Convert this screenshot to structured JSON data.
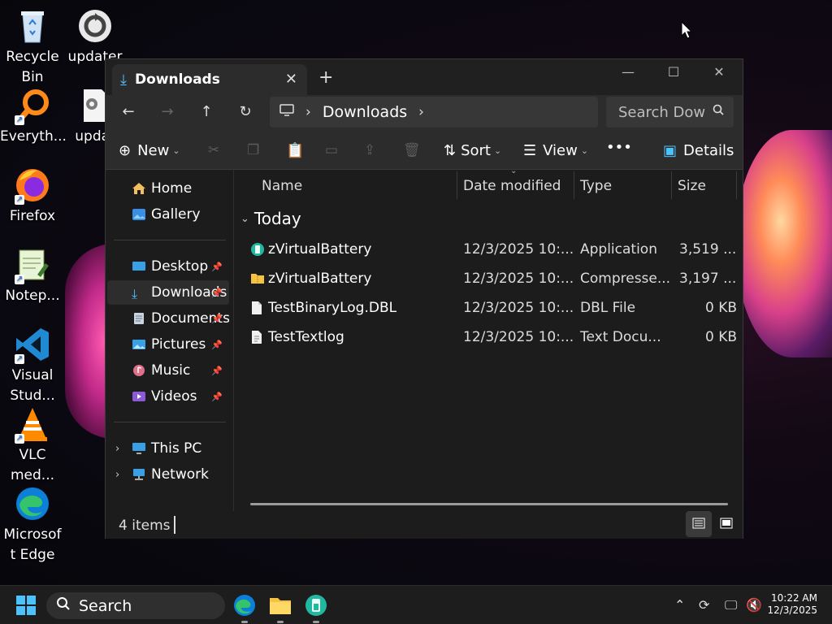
{
  "desktop": {
    "icons": [
      {
        "label": "Recycle Bin",
        "icon": "recycle-bin-icon"
      },
      {
        "label": "updater",
        "icon": "updater-icon"
      },
      {
        "label": "Everyth...",
        "icon": "everything-icon"
      },
      {
        "label": "updat",
        "icon": "updater-gear-icon"
      },
      {
        "label": "Firefox",
        "icon": "firefox-icon"
      },
      {
        "label": "Notep...",
        "icon": "notepad-icon"
      },
      {
        "label": "Visual Stud...",
        "icon": "visual-studio-code-icon"
      },
      {
        "label": "VLC med...",
        "icon": "vlc-icon"
      },
      {
        "label": "Microsof t Edge",
        "icon": "edge-icon"
      }
    ]
  },
  "window": {
    "tab_title": "Downloads",
    "tab_close": "✕",
    "new_tab": "+",
    "minimize": "—",
    "maximize": "☐",
    "close": "✕"
  },
  "navbar": {
    "back": "←",
    "forward": "→",
    "up": "↑",
    "refresh": "↻",
    "breadcrumb": "Downloads",
    "search_placeholder": "Search Dow"
  },
  "toolbar": {
    "new_label": "New",
    "sort_label": "Sort",
    "view_label": "View",
    "more_label": "•••",
    "details_label": "Details"
  },
  "sidebar": {
    "home": "Home",
    "gallery": "Gallery",
    "desktop": "Desktop",
    "downloads": "Downloads",
    "documents": "Documents",
    "pictures": "Pictures",
    "music": "Music",
    "videos": "Videos",
    "this_pc": "This PC",
    "network": "Network"
  },
  "columns": {
    "name": "Name",
    "date": "Date modified",
    "type": "Type",
    "size": "Size"
  },
  "group": "Today",
  "files": [
    {
      "name": "zVirtualBattery",
      "date": "12/3/2025 10:...",
      "type": "Application",
      "size": "3,519 ...",
      "icon": "application-icon"
    },
    {
      "name": "zVirtualBattery",
      "date": "12/3/2025 10:...",
      "type": "Compresse...",
      "size": "3,197 ...",
      "icon": "zip-folder-icon"
    },
    {
      "name": "TestBinaryLog.DBL",
      "date": "12/3/2025 10:...",
      "type": "DBL File",
      "size": "0 KB",
      "icon": "file-icon"
    },
    {
      "name": "TestTextlog",
      "date": "12/3/2025 10:...",
      "type": "Text Docu...",
      "size": "0 KB",
      "icon": "text-file-icon"
    }
  ],
  "status": {
    "count": "4 items"
  },
  "taskbar": {
    "search_label": "Search",
    "time": "10:22 AM",
    "date": "12/3/2025"
  },
  "colors": {
    "accent": "#4cc2ff",
    "folder": "#f5c242"
  }
}
